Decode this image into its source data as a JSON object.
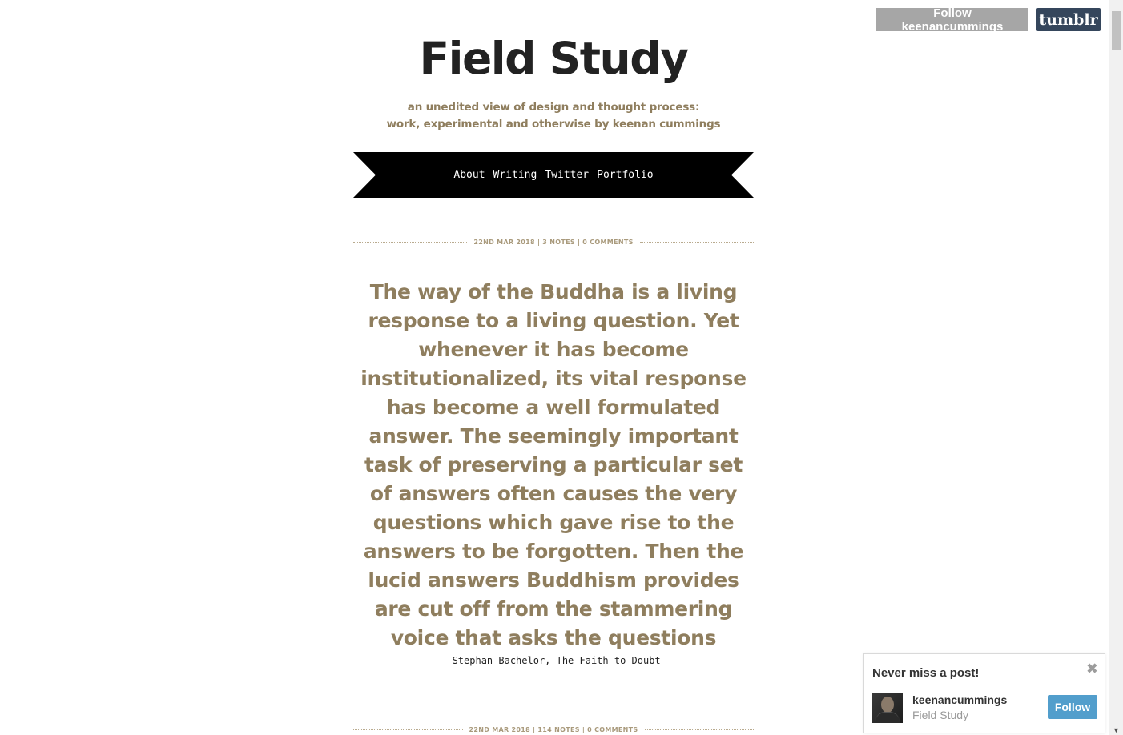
{
  "topbar": {
    "follow_label": "Follow keenancummings",
    "tumblr_label": "tumblr"
  },
  "header": {
    "title": "Field Study",
    "description_line1": "an unedited view of design and thought process:",
    "description_line2_prefix": "work, experimental and otherwise by ",
    "author_link": "keenan cummings"
  },
  "nav": {
    "items": [
      "About",
      "Writing",
      "Twitter",
      "Portfolio"
    ]
  },
  "posts": [
    {
      "meta": "22ND MAR 2018 | 3 NOTES | 0 COMMENTS",
      "quote": "The way of the Buddha is a living response to a living question. Yet whenever it has become institutionalized, its vital response has become a well formulated answer. The seemingly important task of preserving a particular set of answers often causes the very questions which gave rise to the answers to be forgotten. Then the lucid answers Buddhism provides are cut off from the stammering voice that asks the questions",
      "attribution": "—Stephan Bachelor, The Faith to Doubt"
    },
    {
      "meta": "22ND MAR 2018 | 114 NOTES | 0 COMMENTS"
    }
  ],
  "popup": {
    "title": "Never miss a post!",
    "close_glyph": "✖",
    "username": "keenancummings",
    "blog_name": "Field Study",
    "follow_label": "Follow"
  },
  "colors": {
    "accent_text": "#8f7e5e",
    "tumblr_navy": "#35465c",
    "follow_blue": "#529ecc"
  }
}
